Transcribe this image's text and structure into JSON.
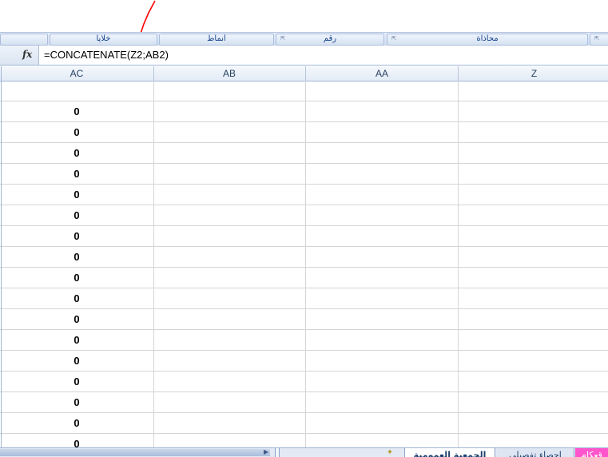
{
  "ribbon": {
    "groups": [
      {
        "label": "خلايا",
        "has_launcher": false
      },
      {
        "label": "أنماط",
        "has_launcher": false
      },
      {
        "label": "رقم",
        "has_launcher": true
      },
      {
        "label": "محاذاة",
        "has_launcher": true
      }
    ]
  },
  "formula_bar": {
    "fx_label": "fx",
    "formula": "=CONCATENATE(Z2;AB2)"
  },
  "columns": [
    "AC",
    "AB",
    "AA",
    "Z"
  ],
  "rows": [
    [
      "",
      "",
      "",
      ""
    ],
    [
      "0",
      "",
      "",
      ""
    ],
    [
      "0",
      "",
      "",
      ""
    ],
    [
      "0",
      "",
      "",
      ""
    ],
    [
      "0",
      "",
      "",
      ""
    ],
    [
      "0",
      "",
      "",
      ""
    ],
    [
      "0",
      "",
      "",
      ""
    ],
    [
      "0",
      "",
      "",
      ""
    ],
    [
      "0",
      "",
      "",
      ""
    ],
    [
      "0",
      "",
      "",
      ""
    ],
    [
      "0",
      "",
      "",
      ""
    ],
    [
      "0",
      "",
      "",
      ""
    ],
    [
      "0",
      "",
      "",
      ""
    ],
    [
      "0",
      "",
      "",
      ""
    ],
    [
      "0",
      "",
      "",
      ""
    ],
    [
      "0",
      "",
      "",
      ""
    ],
    [
      "0",
      "",
      "",
      ""
    ],
    [
      "0",
      "",
      "",
      ""
    ]
  ],
  "sheet_tabs": [
    {
      "label": "الجمعية العمومية",
      "active": true
    },
    {
      "label": "إحصاء تفصيلي",
      "active": false
    },
    {
      "label": "قعكام",
      "active": false
    }
  ],
  "colors": {
    "accent_tab": "#ff55cc",
    "annotation_mark": "#ff0000",
    "header_text": "#27415f"
  }
}
